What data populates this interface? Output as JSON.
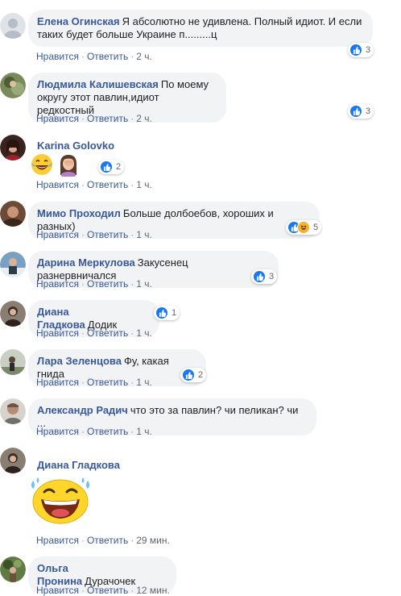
{
  "actions": {
    "like": "Нравится",
    "reply": "Ответить",
    "dot": "·"
  },
  "comments": [
    {
      "author": "Елена Огинская",
      "text": "Я абсолютно не удивлена. Полный идиот. И если таких будет больше Украине п.........ц",
      "time": "2 ч.",
      "reactions": "3"
    },
    {
      "author": "Людмила Калишевская",
      "text": "По моему округу этот павлин,идиот редкостный",
      "time": "2 ч.",
      "reactions": "3"
    },
    {
      "author": "Karina Golovko",
      "text": "",
      "time": "1 ч.",
      "reactions": "2",
      "emojis": [
        "laughing-crying-emoji",
        "facepalm-woman-emoji"
      ]
    },
    {
      "author": "Мимо Проходил",
      "text": "Больше долбоебов, хороших и разных)",
      "time": "1 ч.",
      "reactions": "5"
    },
    {
      "author": "Дарина Меркулова",
      "text": "Закусенец разнервничался",
      "time": "1 ч.",
      "reactions": "3"
    },
    {
      "author": "Диана Гладкова",
      "text": "Додик",
      "time": "1 ч.",
      "reactions": "1"
    },
    {
      "author": "Лара Зеленцова",
      "text": "Фу, какая гнида",
      "time": "1 ч.",
      "reactions": "2"
    },
    {
      "author": "Александр Радич",
      "text": "что это за павлин? чи пеликан? чи ...",
      "time": "1 ч.",
      "reactions": ""
    },
    {
      "author": "Диана Гладкова",
      "text": "",
      "time": "29 мин.",
      "reactions": "",
      "sticker": "laughing-sticker"
    },
    {
      "author": "Ольга Пронина",
      "text": "Дурачочек",
      "time": "12 мин.",
      "reactions": ""
    }
  ],
  "colors": {
    "link": "#385898",
    "bubble": "#f2f3f5",
    "like_blue": "#1877f2",
    "meta": "#606770"
  }
}
